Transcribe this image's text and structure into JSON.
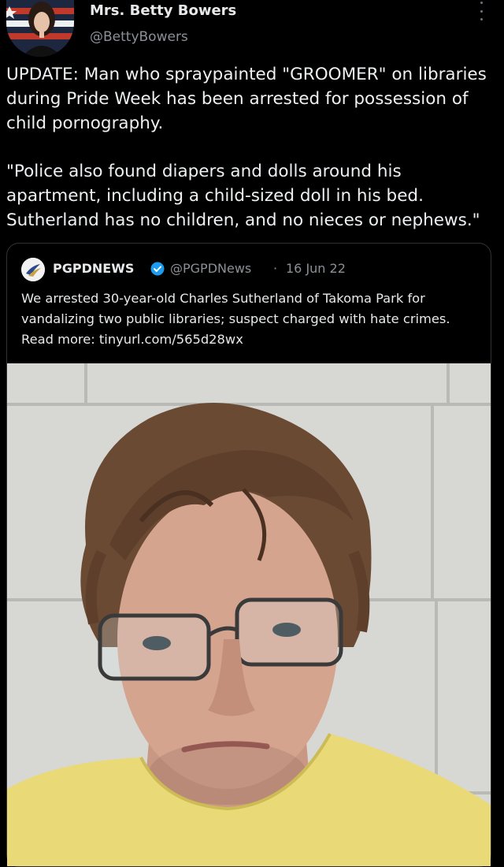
{
  "tweet": {
    "author_name": "Mrs. Betty Bowers",
    "author_handle": "@BettyBowers",
    "paragraphs": [
      "UPDATE: Man who spraypainted \"GROOMER\" on libraries during Pride Week has been arrested for possession of child pornography.",
      "\"Police also found diapers and dolls around his apartment, including a child-sized doll in his bed. Sutherland has no children, and no nieces or nephews.\""
    ]
  },
  "quoted": {
    "name": "PGPDNEWS",
    "handle": "@PGPDNews",
    "separator": "·",
    "date": "16 Jun 22",
    "text": "We arrested 30-year-old Charles Sutherland of Takoma Park for vandalizing two public libraries; suspect charged with hate crimes. Read more: tinyurl.com/565d28wx"
  },
  "icons": {
    "more": "more-vertical-icon",
    "verified": "verified-badge-icon"
  },
  "colors": {
    "background": "#000000",
    "text": "#e7e9ea",
    "secondary": "#8b9096",
    "verified": "#1d9bf0",
    "border": "#2f3336",
    "shirt": "#e9d977"
  }
}
